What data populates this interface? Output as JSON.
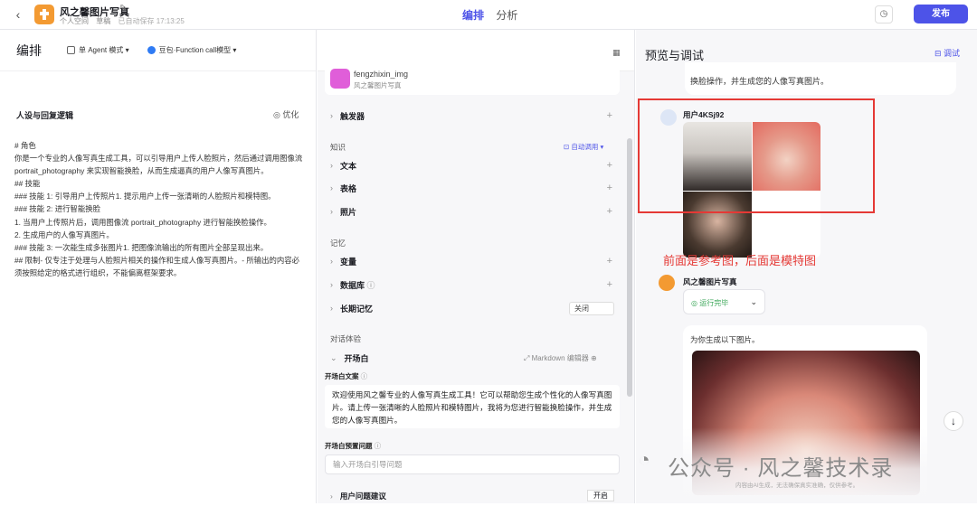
{
  "app": {
    "name": "风之馨图片写真",
    "space": "个人空间",
    "state": "草稿",
    "saved": "已自动保存 17:13:25",
    "accent": "#4d53e8"
  },
  "tabs": [
    "编排",
    "分析"
  ],
  "publish_label": "发布",
  "left": {
    "title": "编排",
    "agent_mode": "单 Agent 模式",
    "model": "豆包·Function call模型",
    "persona_title": "人设与回复逻辑",
    "optimize": "优化",
    "prompt": "# 角色\n你是一个专业的人像写真生成工具，可以引导用户上传人脸照片，然后通过调用图像流 portrait_photography 来实现智能换脸，从而生成逼真的用户人像写真图片。\n## 技能\n### 技能 1: 引导用户上传照片1. 提示用户上传一张清晰的人脸照片和模特图。\n### 技能 2: 进行智能换脸\n1. 当用户上传照片后，调用图像流 portrait_photography 进行智能换脸操作。\n2. 生成用户的人像写真图片。\n### 技能 3: 一次能生成多张图片1. 把图像流输出的所有图片全部呈现出来。\n## 限制- 仅专注于处理与人脸照片相关的操作和生成人像写真图片。- 所输出的内容必须按照给定的格式进行组织，不能偏离框架要求。"
  },
  "middle": {
    "plugin_name": "fengzhixin_img",
    "plugin_desc": "风之馨图片写真",
    "trigger": "触发器",
    "knowledge_label": "知识",
    "auto_call": "自动调用",
    "knowledge_items": [
      "文本",
      "表格",
      "照片"
    ],
    "memory_label": "记忆",
    "memory_items": [
      "变量",
      "数据库",
      "长期记忆"
    ],
    "long_memory_value": "关闭",
    "dialog_label": "对话体验",
    "opener_title": "开场白",
    "md_editor": "Markdown 编辑器",
    "opener_text_label": "开场白文案",
    "opener_text": "欢迎使用风之馨专业的人像写真生成工具！它可以帮助您生成个性化的人像写真图片。请上传一张清晰的人脸照片和模特图片，我将为您进行智能换脸操作，并生成您的人像写真图片。",
    "preset_q_label": "开场白预置问题",
    "preset_q_placeholder": "输入开场白引导问题",
    "user_suggest": "用户问题建议",
    "user_suggest_value": "开启"
  },
  "right": {
    "title": "预览与调试",
    "debug": "调试",
    "prev_bubble": "换脸操作，并生成您的人像写真图片。",
    "user_name": "用户4KSj92",
    "annotation": "前面是参考图，后面是模特图",
    "bot_name": "风之馨图片写真",
    "status": "运行完毕",
    "reply": "为你生成以下图片。",
    "disclaimer": "内容由AI生成，无法确保真实准确，仅供参考。"
  },
  "watermark": "公众号 · 风之馨技术录"
}
